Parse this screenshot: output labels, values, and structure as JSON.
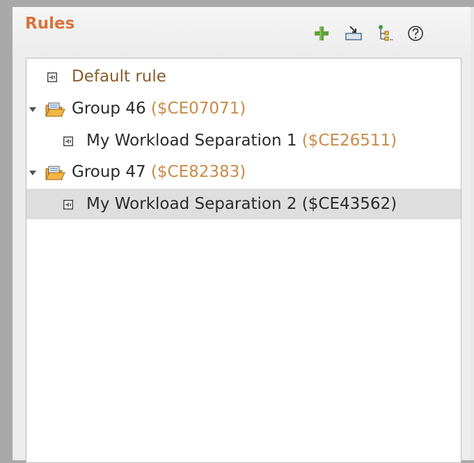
{
  "panel": {
    "title": "Rules",
    "toolbar": {
      "add_icon": "plus-icon",
      "import_icon": "import-icon",
      "hierarchy_icon": "hierarchy-icon",
      "help_icon": "help-icon"
    }
  },
  "tree": {
    "rows": [
      {
        "name": "Default rule",
        "code": ""
      },
      {
        "name": "Group 46",
        "code": "($CE07071)"
      },
      {
        "name": "My Workload Separation 1",
        "code": "($CE26511)"
      },
      {
        "name": "Group 47",
        "code": "($CE82383)"
      },
      {
        "name": "My Workload Separation 2",
        "code": "($CE43562)"
      }
    ]
  },
  "colors": {
    "title": "#d9733a",
    "rule_text": "#8a5b2a",
    "code_text": "#c88b46",
    "selection": "#dedede"
  }
}
